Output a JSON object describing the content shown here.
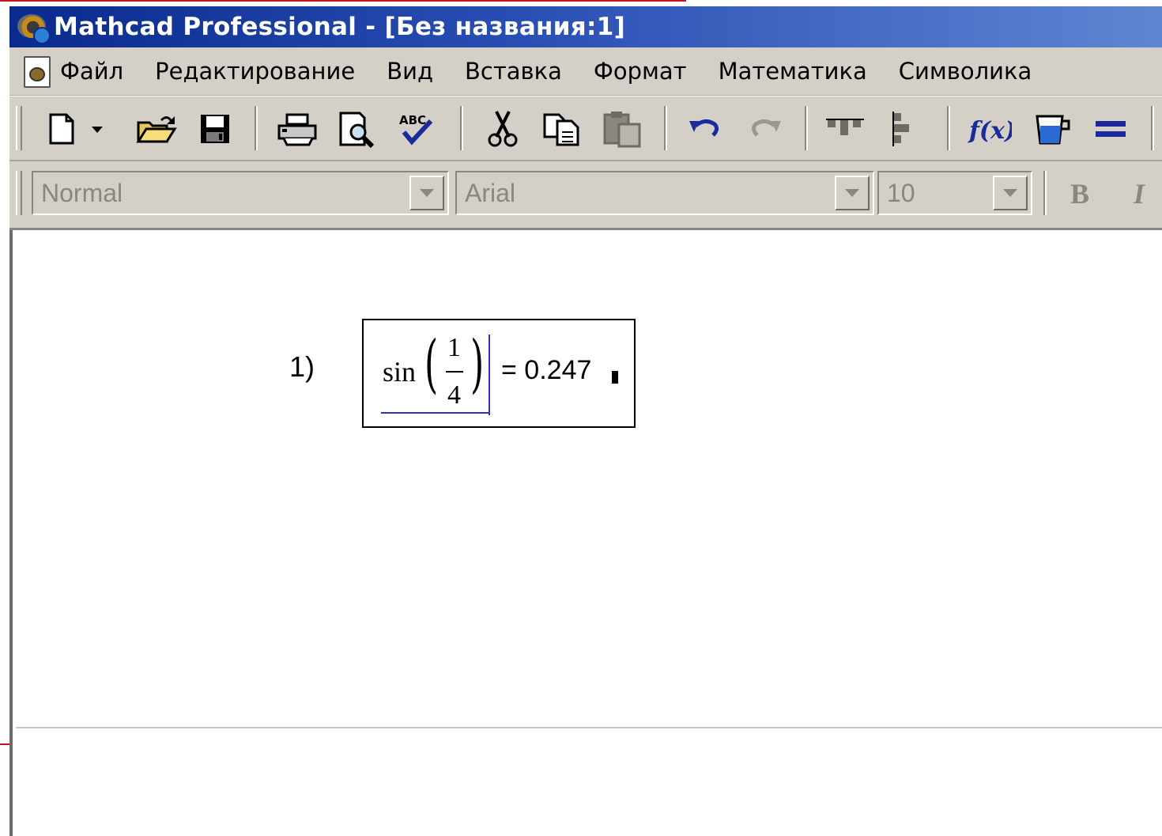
{
  "window": {
    "title": "Mathcad Professional - [Без названия:1]"
  },
  "menu": {
    "items": [
      "Файл",
      "Редактирование",
      "Вид",
      "Вставка",
      "Формат",
      "Математика",
      "Символика"
    ]
  },
  "toolbar": {
    "buttons": [
      "new-document",
      "new-dropdown",
      "open",
      "save",
      "print",
      "print-preview",
      "spell-check",
      "cut",
      "copy",
      "paste",
      "undo",
      "redo",
      "align-across",
      "align-down",
      "insert-function",
      "insert-unit",
      "calculate"
    ]
  },
  "format_bar": {
    "style_value": "Normal",
    "font_value": "Arial",
    "size_value": "10",
    "bold_label": "B",
    "italic_label": "I"
  },
  "worksheet": {
    "region_label": "1)",
    "expression": {
      "function": "sin",
      "numerator": "1",
      "denominator": "4",
      "result": "= 0.247"
    }
  }
}
